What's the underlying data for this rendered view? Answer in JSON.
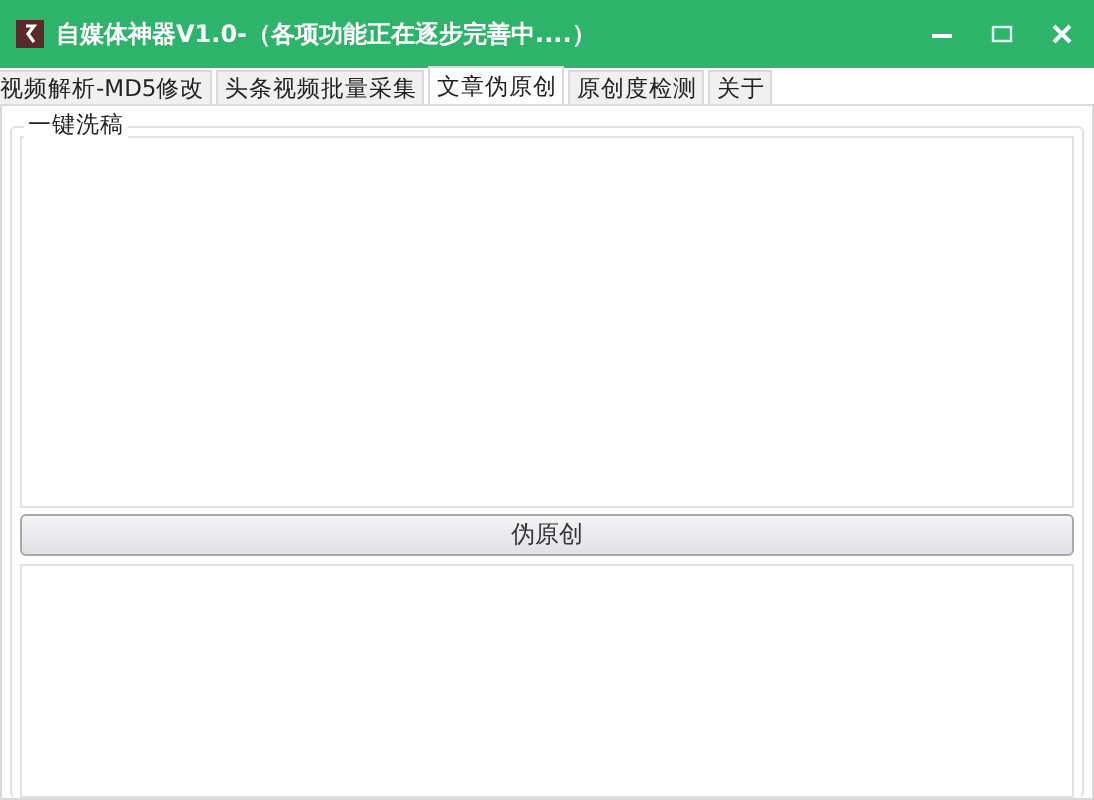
{
  "window": {
    "title": "自媒体神器V1.0-（各项功能正在逐步完善中....）"
  },
  "tabs": [
    {
      "label": "视频解析-MD5修改",
      "selected": false
    },
    {
      "label": "头条视频批量采集",
      "selected": false
    },
    {
      "label": "文章伪原创",
      "selected": true
    },
    {
      "label": "原创度检测",
      "selected": false
    },
    {
      "label": "关于",
      "selected": false
    }
  ],
  "group": {
    "title": "一键洗稿"
  },
  "button": {
    "label": "伪原创"
  }
}
